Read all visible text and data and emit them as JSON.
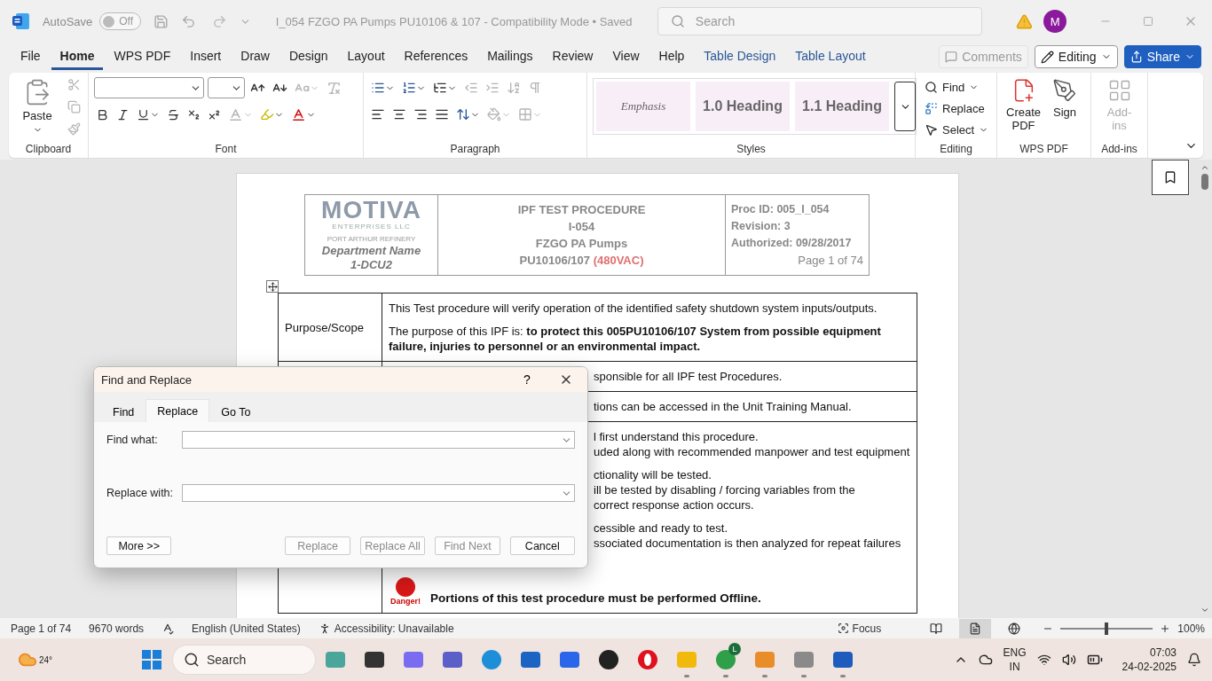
{
  "title_bar": {
    "autosave_label": "AutoSave",
    "autosave": {
      "on": false,
      "label": "Off"
    },
    "document_title": "I_054 FZGO PA Pumps PU10106 & 107 - Compatibility Mode • Saved",
    "search_placeholder": "Search",
    "avatar": "M"
  },
  "ribbon_tabs": [
    {
      "label": "File",
      "selected": false,
      "kind": "normal"
    },
    {
      "label": "Home",
      "selected": true,
      "kind": "normal"
    },
    {
      "label": "WPS PDF",
      "selected": false,
      "kind": "normal"
    },
    {
      "label": "Insert",
      "selected": false,
      "kind": "normal"
    },
    {
      "label": "Draw",
      "selected": false,
      "kind": "normal"
    },
    {
      "label": "Design",
      "selected": false,
      "kind": "normal"
    },
    {
      "label": "Layout",
      "selected": false,
      "kind": "normal"
    },
    {
      "label": "References",
      "selected": false,
      "kind": "normal"
    },
    {
      "label": "Mailings",
      "selected": false,
      "kind": "normal"
    },
    {
      "label": "Review",
      "selected": false,
      "kind": "normal"
    },
    {
      "label": "View",
      "selected": false,
      "kind": "normal"
    },
    {
      "label": "Help",
      "selected": false,
      "kind": "normal"
    },
    {
      "label": "Table Design",
      "selected": false,
      "kind": "contextual"
    },
    {
      "label": "Table Layout",
      "selected": false,
      "kind": "contextual"
    }
  ],
  "ribbon_actions": {
    "comments": {
      "label": "Comments",
      "disabled": true
    },
    "editing": "Editing",
    "share": "Share"
  },
  "clipboard": {
    "group": "Clipboard",
    "paste": "Paste"
  },
  "font": {
    "group": "Font"
  },
  "paragraph": {
    "group": "Paragraph"
  },
  "styles": {
    "group": "Styles",
    "items": [
      {
        "label": "Emphasis",
        "kind": "emphasis"
      },
      {
        "label": "1.0 Heading",
        "kind": "heading"
      },
      {
        "label": "1.1 Heading",
        "kind": "heading"
      }
    ]
  },
  "editing": {
    "group": "Editing",
    "items": [
      {
        "label": "Find",
        "kind": "find"
      },
      {
        "label": "Replace",
        "kind": "replace"
      },
      {
        "label": "Select",
        "kind": "select"
      }
    ]
  },
  "wps_pdf": {
    "group": "WPS PDF",
    "items": [
      {
        "label": "Create PDF",
        "kind": "create"
      },
      {
        "label": "Sign",
        "kind": "sign"
      }
    ]
  },
  "add_ins": {
    "group": "Add-ins",
    "button": {
      "label": "Add-ins",
      "disabled": true
    }
  },
  "document": {
    "header": {
      "logo": {
        "name": "MOTIVA",
        "subtitle": "ENTERPRISES LLC",
        "site": "PORT ARTHUR REFINERY",
        "department": "Department Name",
        "unit": "1-DCU2"
      },
      "procedure": [
        "IPF TEST PROCEDURE",
        "I-054",
        "FZGO PA Pumps"
      ],
      "procedure_last": {
        "text": "PU10106/107",
        "note": "(480VAC)"
      },
      "info": [
        "Proc ID: 005_I_054",
        "Revision: 3",
        "Authorized: 09/28/2017"
      ],
      "page": "Page 1 of 74"
    },
    "rows": [
      {
        "label": "Purpose/Scope",
        "blocks": [
          [
            "This Test procedure will verify operation of the identified safety shutdown system inputs/outputs."
          ],
          [
            "The purpose of this IPF is:  **to protect this 005PU10106/107 System from possible equipment failure, injuries to personnel or an environmental impact.**"
          ]
        ]
      },
      {
        "blocks": [
          [
            "sponsible for all IPF test Procedures."
          ]
        ]
      },
      {
        "blocks": [
          [
            "tions can be accessed in the Unit Training Manual."
          ]
        ]
      },
      {
        "blocks": [
          [
            "l first understand this procedure.",
            "uded along with recommended manpower and test equipment"
          ],
          [
            "ctionality will be tested.",
            "ill be tested by disabling / forcing variables from the",
            "correct response action occurs."
          ],
          [
            "cessible and ready to test.",
            "ssociated documentation is then analyzed for repeat failures"
          ]
        ],
        "warning": {
          "badge": "Danger!",
          "text": "Portions of this test procedure must be performed Offline."
        }
      }
    ]
  },
  "dialog": {
    "title": "Find and Replace",
    "help": "?",
    "tabs": [
      {
        "label": "Find",
        "selected": false
      },
      {
        "label": "Replace",
        "selected": true
      },
      {
        "label": "Go To",
        "selected": false
      }
    ],
    "fields": [
      {
        "label": "Find what:"
      },
      {
        "label": "Replace with:"
      }
    ],
    "more": "More >>",
    "buttons": [
      {
        "label": "Replace",
        "disabled": true
      },
      {
        "label": "Replace All",
        "disabled": true
      },
      {
        "label": "Find Next",
        "disabled": true
      },
      {
        "label": "Cancel",
        "disabled": false
      }
    ]
  },
  "status_bar": {
    "page": "Page 1 of 74",
    "words": "9670 words",
    "language": "English (United States)",
    "accessibility": "Accessibility: Unavailable",
    "focus": "Focus",
    "views": [
      {
        "kind": "read",
        "selected": false
      },
      {
        "kind": "print",
        "selected": true
      },
      {
        "kind": "web",
        "selected": false
      }
    ],
    "zoom": {
      "level": 0.5,
      "label": "100%"
    }
  },
  "taskbar": {
    "weather": "24°",
    "search": "Search",
    "apps": [
      {
        "kind": "art",
        "running": false
      },
      {
        "kind": "taskview",
        "running": false
      },
      {
        "kind": "copilot",
        "running": false
      },
      {
        "kind": "teams",
        "running": false
      },
      {
        "kind": "edge",
        "running": false
      },
      {
        "kind": "store",
        "running": false
      },
      {
        "kind": "automate",
        "running": false
      },
      {
        "kind": "dell",
        "running": false
      },
      {
        "kind": "opera",
        "running": false
      },
      {
        "kind": "folder",
        "running": true
      },
      {
        "kind": "chrome",
        "running": true,
        "badge": "L"
      },
      {
        "kind": "flower",
        "running": true
      },
      {
        "kind": "portrait",
        "running": true
      },
      {
        "kind": "word",
        "running": true
      }
    ],
    "language": [
      "ENG",
      "IN"
    ],
    "time": "07:03",
    "date": "24-02-2025"
  }
}
